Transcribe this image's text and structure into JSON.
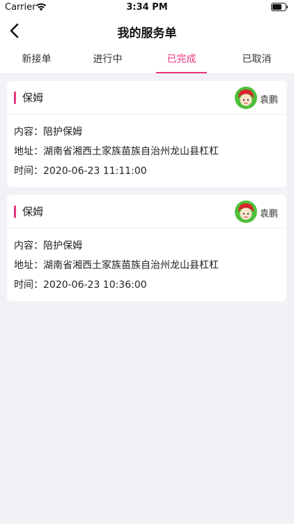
{
  "status_bar": {
    "carrier": "Carrier",
    "time": "3:34 PM"
  },
  "nav": {
    "title": "我的服务单"
  },
  "tabs": [
    {
      "label": "新接单",
      "active": false
    },
    {
      "label": "进行中",
      "active": false
    },
    {
      "label": "已完成",
      "active": true
    },
    {
      "label": "已取消",
      "active": false
    }
  ],
  "orders": [
    {
      "service": "保姆",
      "user": "袁鹏",
      "content_label": "内容：",
      "content": "陪护保姆",
      "address_label": "地址：",
      "address": "湖南省湘西土家族苗族自治州龙山县杠杠",
      "time_label": "时间：",
      "time": "2020-06-23 11:11:00"
    },
    {
      "service": "保姆",
      "user": "袁鹏",
      "content_label": "内容：",
      "content": "陪护保姆",
      "address_label": "地址：",
      "address": "湖南省湘西土家族苗族自治州龙山县杠杠",
      "time_label": "时间：",
      "time": "2020-06-23 10:36:00"
    }
  ],
  "colors": {
    "accent": "#e8367d",
    "background": "#f2f1f6",
    "card": "#ffffff"
  },
  "icons": {
    "back": "chevron-left-icon",
    "wifi": "wifi-icon",
    "battery": "battery-icon",
    "avatar": "user-avatar"
  }
}
